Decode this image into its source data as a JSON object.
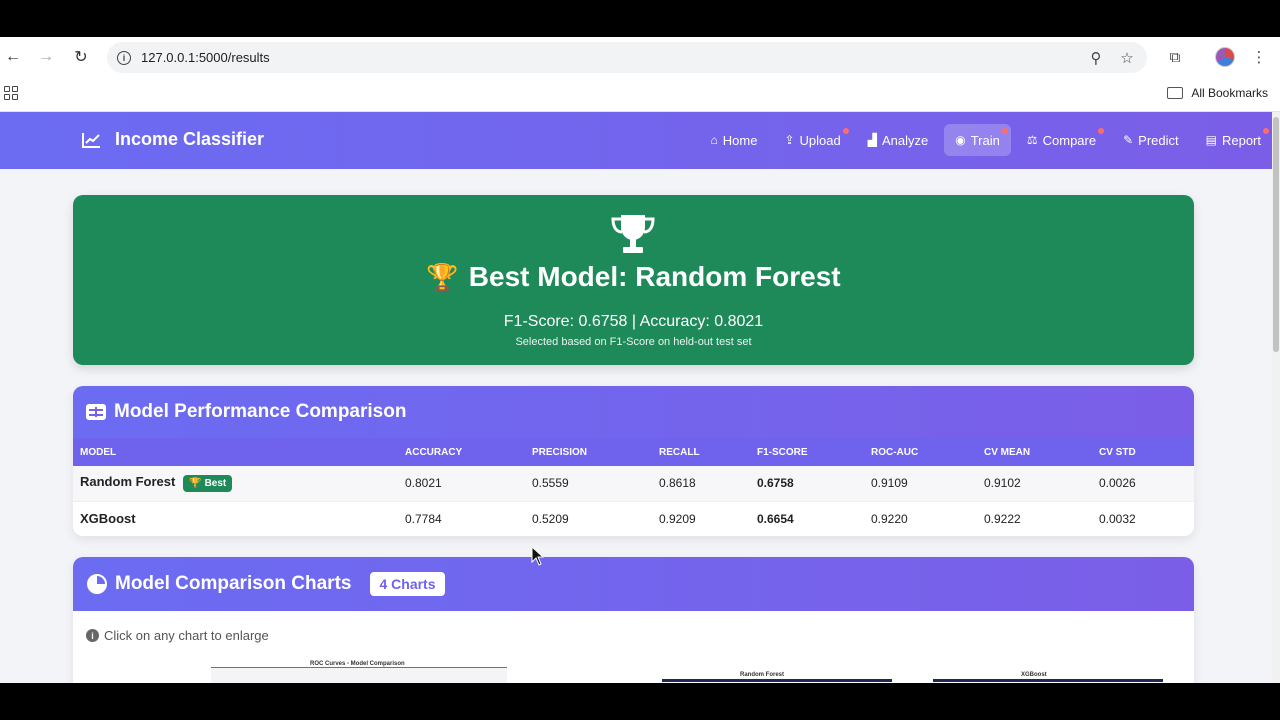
{
  "browser": {
    "url": "127.0.0.1:5000/results",
    "bookmarks_label": "All Bookmarks"
  },
  "app": {
    "brand": "Income Classifier",
    "menu": [
      {
        "label": "Home",
        "icon": "home-icon",
        "dot": false,
        "active": false
      },
      {
        "label": "Upload",
        "icon": "upload-icon",
        "dot": true,
        "active": false
      },
      {
        "label": "Analyze",
        "icon": "chart-icon",
        "dot": false,
        "active": false
      },
      {
        "label": "Train",
        "icon": "robot-icon",
        "dot": true,
        "active": true
      },
      {
        "label": "Compare",
        "icon": "scale-icon",
        "dot": true,
        "active": false
      },
      {
        "label": "Predict",
        "icon": "pencil-icon",
        "dot": false,
        "active": false
      },
      {
        "label": "Report",
        "icon": "file-icon",
        "dot": true,
        "active": false
      }
    ]
  },
  "best": {
    "title": "Best Model: Random Forest",
    "metrics": "F1-Score: 0.6758 | Accuracy: 0.8021",
    "subtitle": "Selected based on F1-Score on held-out test set"
  },
  "performance": {
    "title": "Model Performance Comparison",
    "columns": [
      "MODEL",
      "ACCURACY",
      "PRECISION",
      "RECALL",
      "F1-SCORE",
      "ROC-AUC",
      "CV MEAN",
      "CV STD"
    ],
    "rows": [
      {
        "model": "Random Forest",
        "badge": "🏆 Best",
        "accuracy": "0.8021",
        "precision": "0.5559",
        "recall": "0.8618",
        "f1": "0.6758",
        "roc_auc": "0.9109",
        "cv_mean": "0.9102",
        "cv_std": "0.0026"
      },
      {
        "model": "XGBoost",
        "badge": "",
        "accuracy": "0.7784",
        "precision": "0.5209",
        "recall": "0.9209",
        "f1": "0.6654",
        "roc_auc": "0.9220",
        "cv_mean": "0.9222",
        "cv_std": "0.0032"
      }
    ]
  },
  "charts": {
    "title": "Model Comparison Charts",
    "count_badge": "4 Charts",
    "hint": "Click on any chart to enlarge",
    "thumb_titles": [
      "ROC Curves - Model Comparison",
      "Random Forest",
      "XGBoost"
    ]
  },
  "colors": {
    "accent": "#6f63ee",
    "success": "#1e8a5a",
    "notify_dot": "#ff6b6b"
  }
}
